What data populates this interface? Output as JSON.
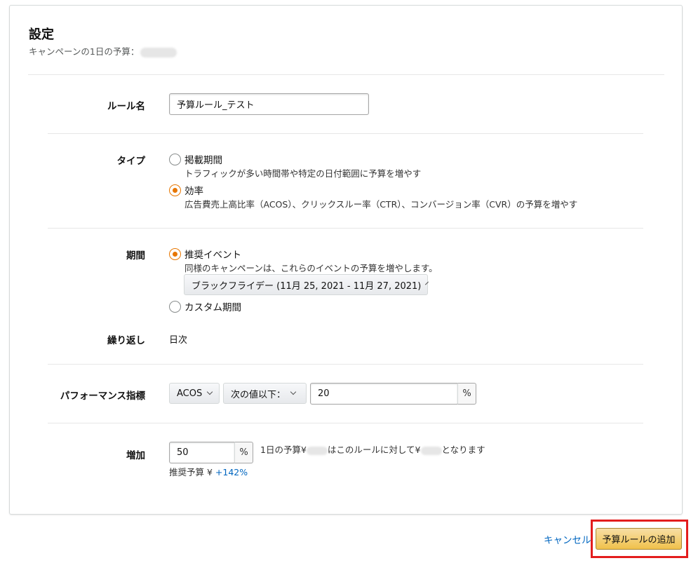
{
  "header": {
    "title": "設定",
    "subtitle": "キャンペーンの1日の予算："
  },
  "rule_name": {
    "label": "ルール名",
    "value": "予算ルール_テスト"
  },
  "type": {
    "label": "タイプ",
    "options": [
      {
        "label": "掲載期間",
        "description": "トラフィックが多い時間帯や特定の日付範囲に予算を増やす",
        "checked": false
      },
      {
        "label": "効率",
        "description": "広告費売上高比率（ACOS）、クリックスルー率（CTR）、コンバージョン率（CVR）の予算を増やす",
        "checked": true
      }
    ]
  },
  "period": {
    "label": "期間",
    "recommended": {
      "label": "推奨イベント",
      "description": "同様のキャンペーンは、これらのイベントの予算を増やします。",
      "checked": true
    },
    "event_select": "ブラックフライデー (11月 25, 2021 - 11月 27, 2021)",
    "custom": {
      "label": "カスタム期間",
      "checked": false
    }
  },
  "repeat": {
    "label": "繰り返し",
    "value": "日次"
  },
  "performance": {
    "label": "パフォーマンス指標",
    "metric": "ACOS",
    "condition": "次の値以下：",
    "value": "20",
    "unit": "%"
  },
  "increase": {
    "label": "増加",
    "value": "50",
    "unit": "%",
    "info_prefix": "1日の予算¥",
    "info_middle": "はこのルールに対して¥",
    "info_suffix": "となります",
    "recommended_prefix": "推奨予算 ¥ ",
    "recommended_value": "+142%"
  },
  "footer": {
    "cancel": "キャンセル",
    "submit": "予算ルールの追加"
  },
  "colors": {
    "accent": "#e77600",
    "link": "#0066c0",
    "primary_button": "#f0c14b",
    "highlight": "#e31d1d"
  }
}
